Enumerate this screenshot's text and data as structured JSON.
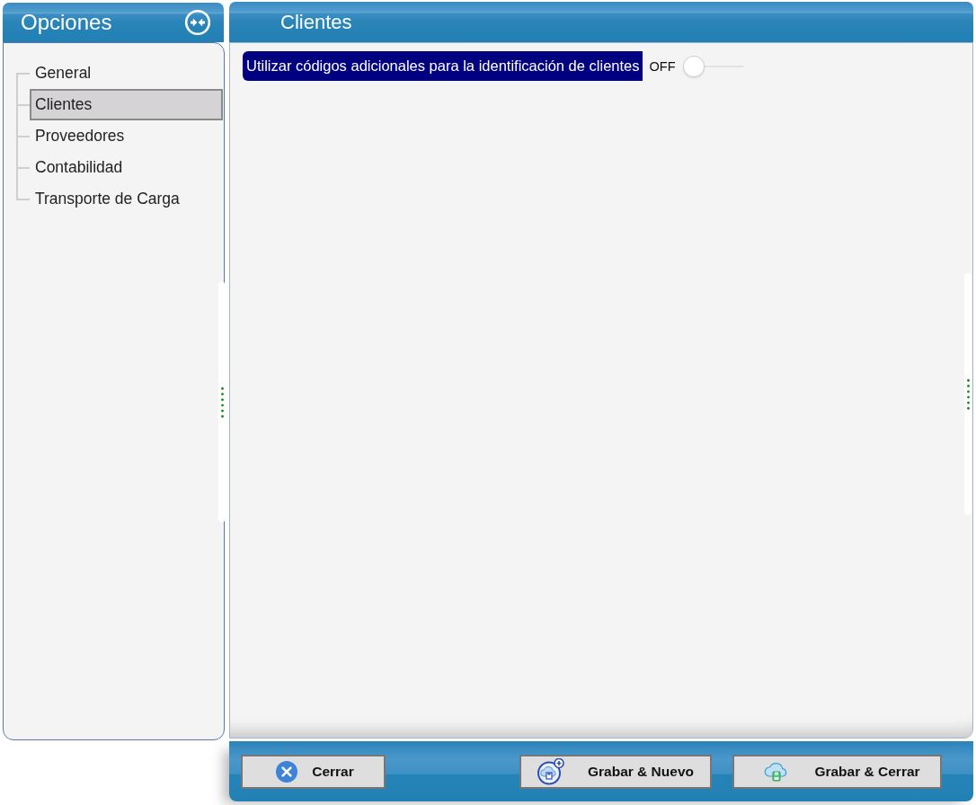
{
  "sidebar": {
    "title": "Opciones",
    "items": [
      {
        "label": "General",
        "selected": false
      },
      {
        "label": "Clientes",
        "selected": true
      },
      {
        "label": "Proveedores",
        "selected": false
      },
      {
        "label": "Contabilidad",
        "selected": false
      },
      {
        "label": "Transporte de Carga",
        "selected": false
      }
    ]
  },
  "panel": {
    "title": "Clientes",
    "options": [
      {
        "label": "Utilizar códigos adicionales para la identificación de clientes",
        "state_label": "OFF",
        "on": false
      }
    ]
  },
  "buttons": [
    {
      "label": "Cerrar",
      "kind": "close"
    },
    {
      "label": "Grabar & Nuevo",
      "kind": "save_new"
    },
    {
      "label": "Grabar & Cerrar",
      "kind": "save_close"
    }
  ]
}
